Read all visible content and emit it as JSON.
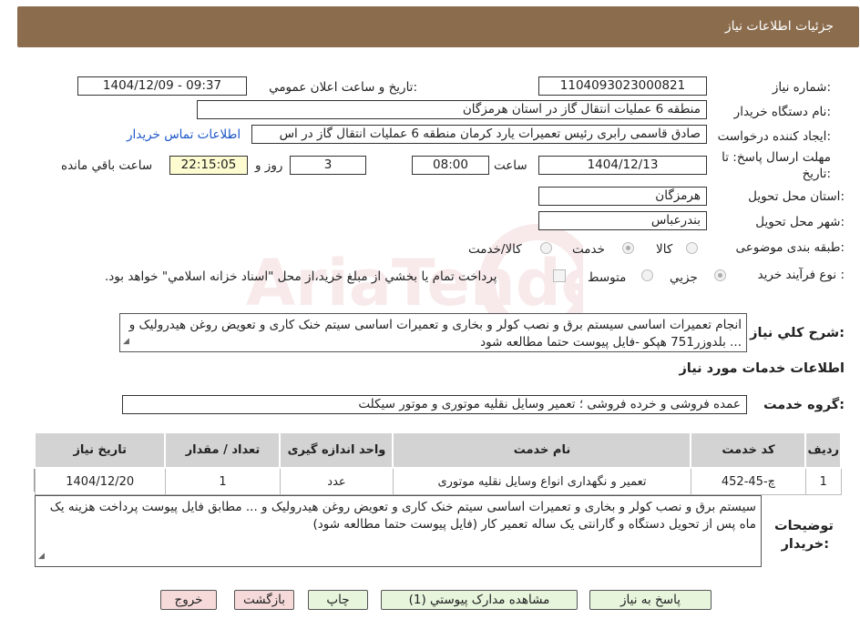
{
  "header": {
    "title": "جزئیات اطلاعات نیاز"
  },
  "labels": {
    "need_number": "شماره نیاز:",
    "announce_datetime": "تاریخ و ساعت اعلان عمومي:",
    "buyer_org": "نام دستگاه خريدار:",
    "requester": "ايجاد كننده درخواست:",
    "deadline": "مهلت ارسال پاسخ: تا تاریخ:",
    "time": "ساعت",
    "days_and": "روز و",
    "remaining": "ساعت باقي مانده",
    "province": "استان محل تحويل:",
    "city": "شهر محل تحويل:",
    "category": "طبقه بندی موضوعی:",
    "process": "نوع فرآیند خرید :",
    "summary": "شرح كلي نياز:",
    "services_section": "اطلاعات خدمات مورد نياز",
    "service_group": "گروه خدمت:",
    "buyer_notes": "توضيحات خريدار:"
  },
  "fields": {
    "need_number": "1104093023000821",
    "announce_datetime": "1404/12/09 - 09:37",
    "buyer_org": "منطقه 6 عملیات انتقال گاز در استان هرمزگان",
    "requester": "صادق قاسمی رابری رئیس تعمیرات یارد کرمان منطقه 6 عملیات انتقال گاز در اس",
    "deadline_date": "1404/12/13",
    "deadline_time": "08:00",
    "days": "3",
    "remaining_time": "22:15:05",
    "province": "هرمزگان",
    "city": "بندرعباس",
    "summary": "انجام تعمیرات اساسی سیستم برق و نصب کولر و بخاری و تعمیرات اساسی سیتم خنک کاری و تعویض روغن هیدرولیک و ... بلدوزر751 هپکو -فایل پیوست حتما مطالعه شود",
    "service_group": "عمده فروشی و خرده فروشی ؛ تعمیر وسایل نقلیه موتوری و موتور سیکلت",
    "buyer_notes": "سیستم برق و نصب کولر و بخاری و تعمیرات اساسی سیتم خنک کاری و تعویض روغن هیدرولیک و ... مطابق فایل پیوست پرداخت هزینه یک ماه پس از تحویل دستگاه و گارانتی یک ساله تعمیر کار (فایل پیوست حتما مطالعه شود)"
  },
  "contact_link": "اطلاعات تماس خريدار",
  "category_options": {
    "goods": "كالا",
    "service": "خدمت",
    "goods_service": "كالا/خدمت",
    "selected": "service"
  },
  "process_options": {
    "partial": "جزيي",
    "medium": "متوسط",
    "selected": "partial",
    "treasury_note": "پرداخت تمام يا بخشي از مبلغ خريد،از محل \"اسناد خزانه اسلامي\" خواهد بود."
  },
  "table": {
    "headers": [
      "رديف",
      "كد خدمت",
      "نام خدمت",
      "واحد اندازه گيری",
      "تعداد / مقدار",
      "تاريخ نياز"
    ],
    "rows": [
      [
        "1",
        "چ-45-452",
        "تعمیر و نگهداری انواع وسایل نقلیه موتوری",
        "عدد",
        "1",
        "1404/12/20"
      ]
    ]
  },
  "buttons": {
    "respond": "پاسخ به نياز",
    "attachments": "مشاهده مدارک پيوستي (1)",
    "print": "چاپ",
    "back": "بازگشت",
    "exit": "خروج"
  },
  "colors": {
    "header_bg": "#8b6d4d",
    "link": "#1c56c8",
    "table_header_bg": "#d3d3d3",
    "green_button": "#e6f5dc",
    "pink_button": "#f6dada",
    "remaining_bg": "#fdfbd0"
  }
}
